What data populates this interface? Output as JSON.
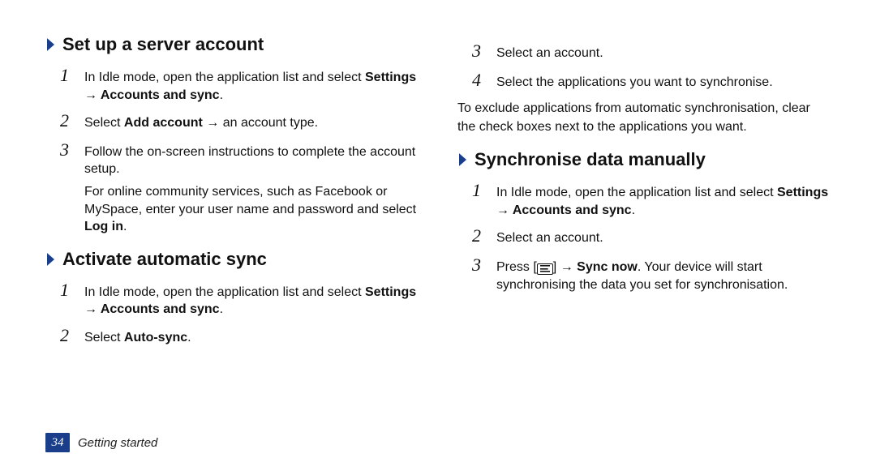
{
  "page_number": "34",
  "section_name": "Getting started",
  "left": {
    "s1": {
      "title": "Set up a server account",
      "steps": [
        {
          "n": "1",
          "line1": "In Idle mode, open the application list and select ",
          "bold": "Settings → Accounts and sync",
          "tail": "."
        },
        {
          "n": "2",
          "line1": "Select ",
          "bold": "Add account",
          "mid": " → an account type."
        },
        {
          "n": "3",
          "line1": "Follow the on-screen instructions to complete the account setup.",
          "sub1": "For online community services, such as Facebook or MySpace, enter your user name and password and select ",
          "subbold": "Log in",
          "subtail": "."
        }
      ]
    },
    "s2": {
      "title": "Activate automatic sync",
      "steps": [
        {
          "n": "1",
          "line1": "In Idle mode, open the application list and select ",
          "bold": "Settings → Accounts and sync",
          "tail": "."
        },
        {
          "n": "2",
          "line1": "Select ",
          "bold": "Auto-sync",
          "tail": "."
        }
      ]
    }
  },
  "right": {
    "cont_steps": [
      {
        "n": "3",
        "line1": "Select an account."
      },
      {
        "n": "4",
        "line1": "Select the applications you want to synchronise."
      }
    ],
    "note": "To exclude applications from automatic synchronisation, clear the check boxes next to the applications you want.",
    "s3": {
      "title": "Synchronise data manually",
      "steps": [
        {
          "n": "1",
          "line1": "In Idle mode, open the application list and select ",
          "bold": "Settings → Accounts and sync",
          "tail": "."
        },
        {
          "n": "2",
          "line1": "Select an account."
        },
        {
          "n": "3",
          "line1": "Press [",
          "aftericon": "] → ",
          "bold": "Sync now",
          "mid": ". Your device will start synchronising the data you set for synchronisation."
        }
      ]
    }
  }
}
